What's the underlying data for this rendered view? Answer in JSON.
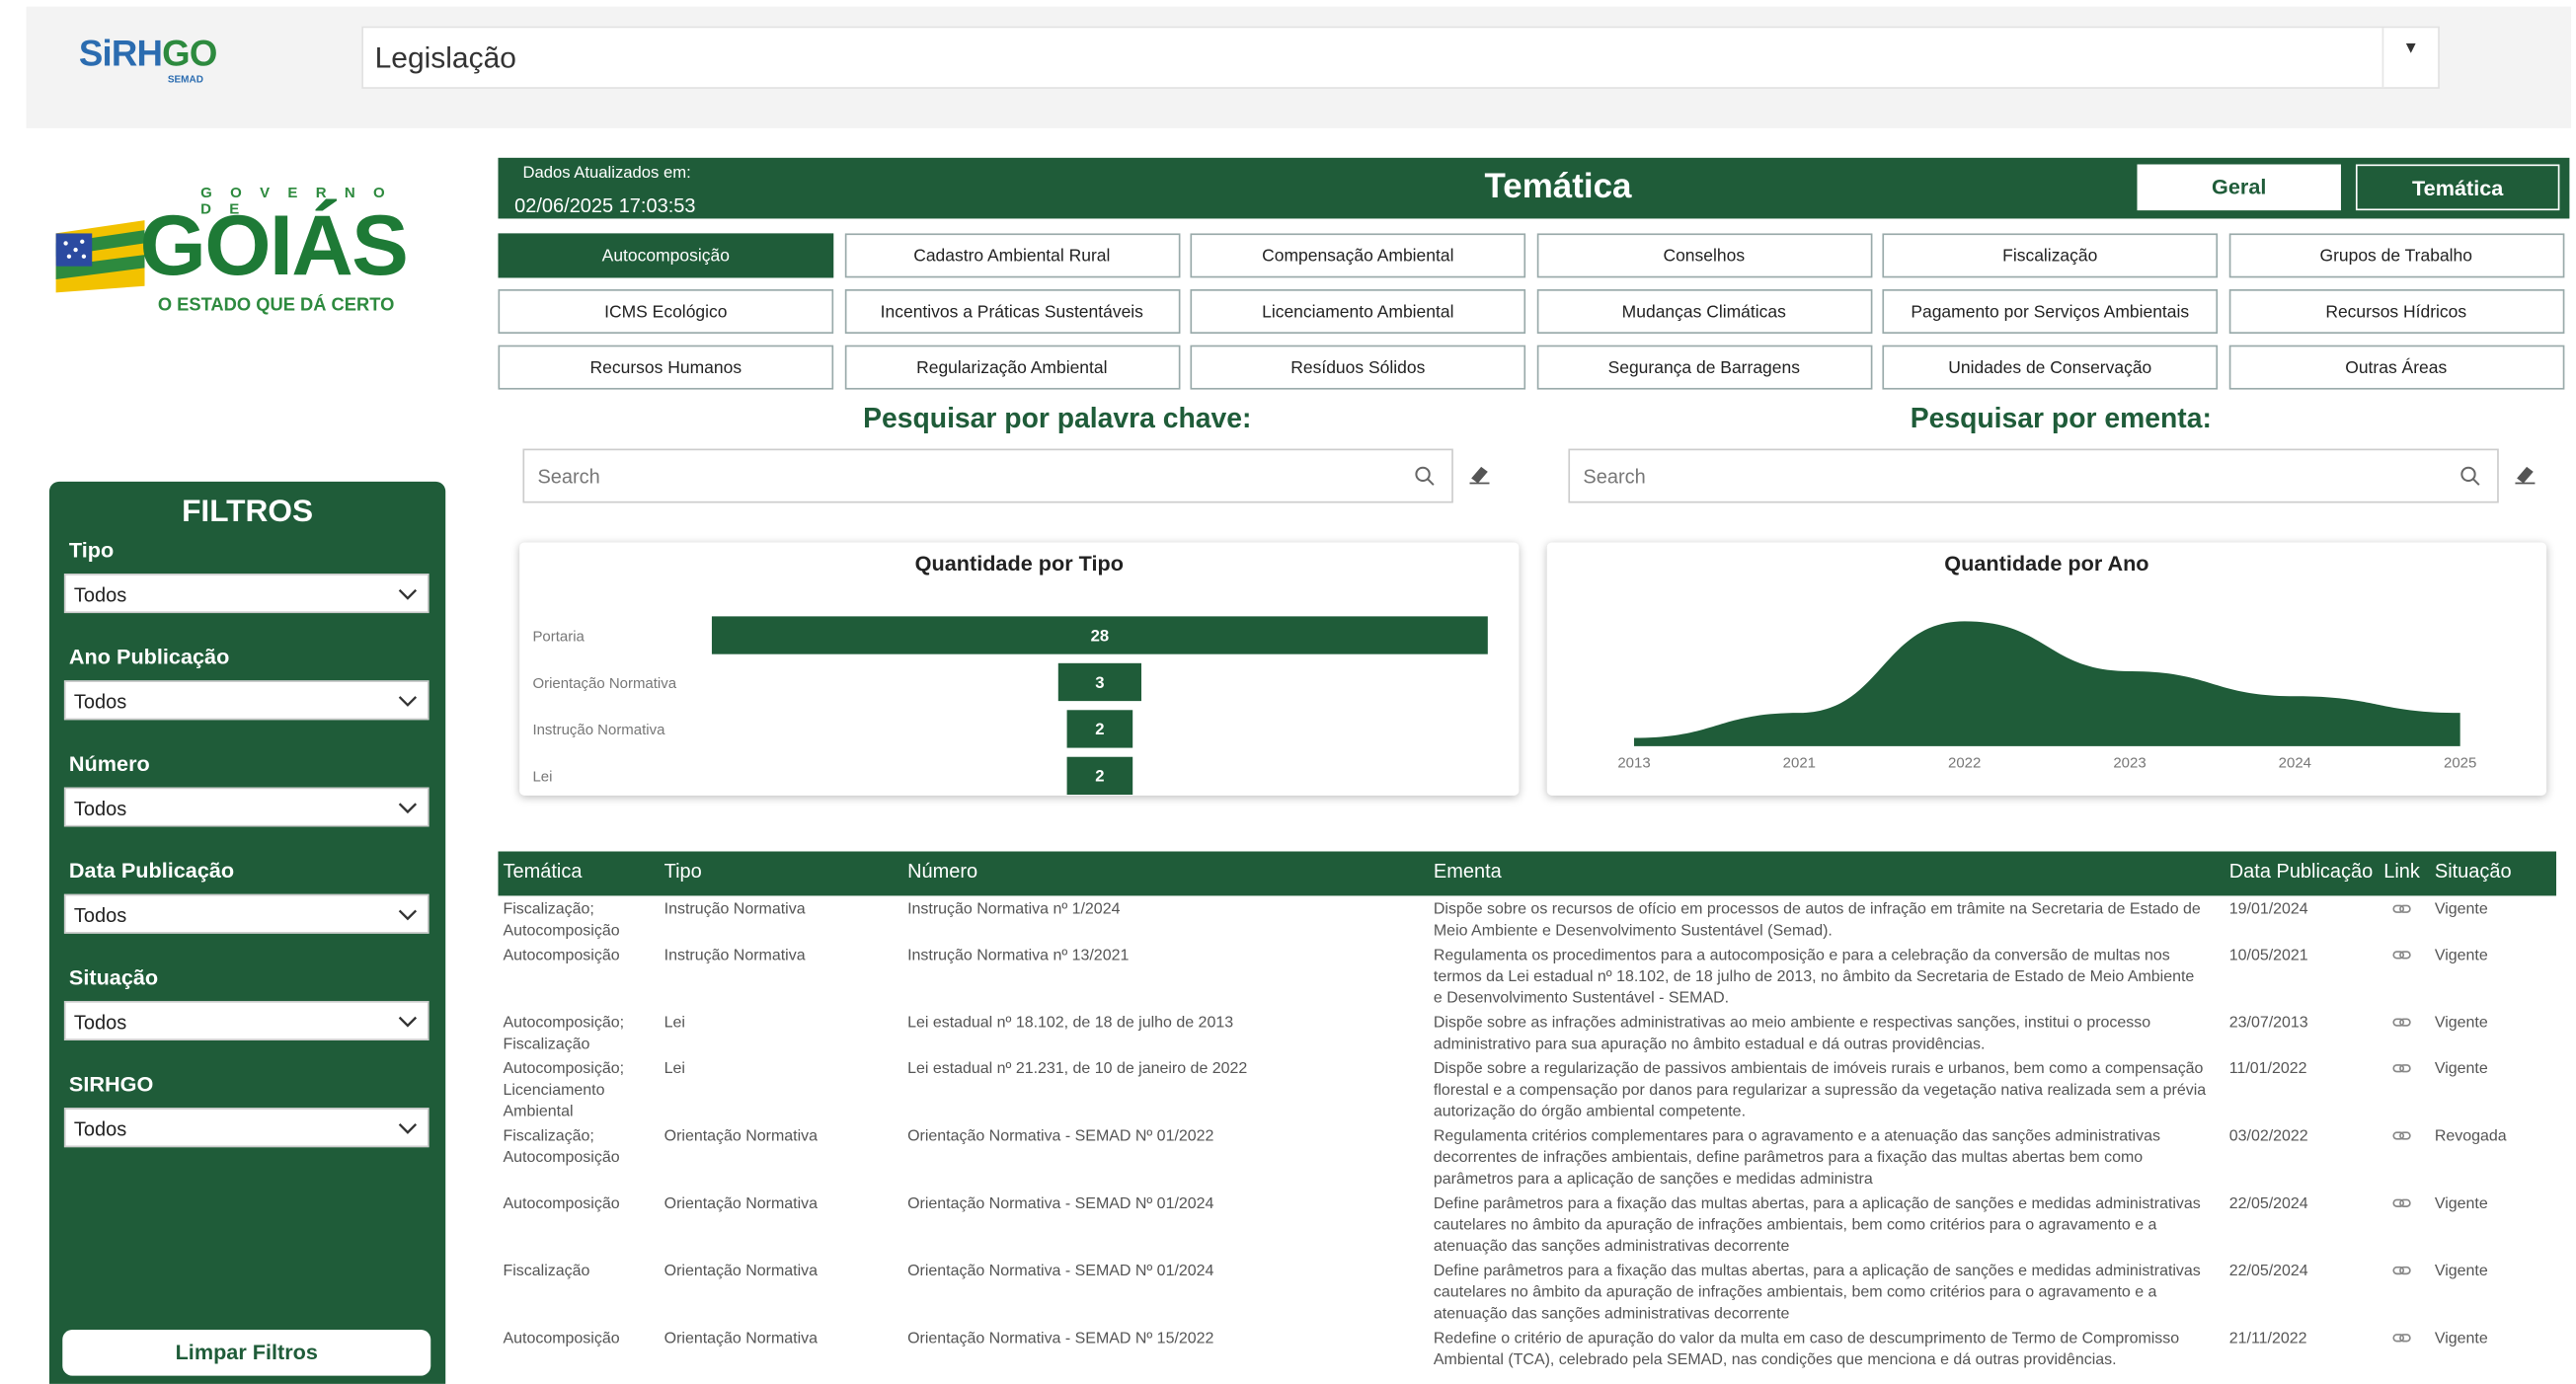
{
  "topbar": {
    "logo_text_a": "SIRHGO",
    "logo_sub": "SEMAD",
    "selected_page": "Legislação"
  },
  "brand": {
    "gov_label": "GOVERNO DE",
    "name": "GOIÁS",
    "slogan": "O ESTADO QUE DÁ CERTO"
  },
  "filters": {
    "title": "FILTROS",
    "items": [
      {
        "label": "Tipo",
        "value": "Todos"
      },
      {
        "label": "Ano Publicação",
        "value": "Todos"
      },
      {
        "label": "Número",
        "value": "Todos"
      },
      {
        "label": "Data Publicação",
        "value": "Todos"
      },
      {
        "label": "Situação",
        "value": "Todos"
      },
      {
        "label": "SIRHGO",
        "value": "Todos"
      }
    ],
    "clear_label": "Limpar Filtros"
  },
  "header": {
    "updated_label": "Dados Atualizados em:",
    "updated_value": "02/06/2025 17:03:53",
    "title": "Temática",
    "btn_geral": "Geral",
    "btn_tematica": "Temática"
  },
  "themes": [
    "Autocomposição",
    "Cadastro Ambiental Rural",
    "Compensação Ambiental",
    "Conselhos",
    "Fiscalização",
    "Grupos de Trabalho",
    "ICMS Ecológico",
    "Incentivos a Práticas Sustentáveis",
    "Licenciamento Ambiental",
    "Mudanças Climáticas",
    "Pagamento por Serviços Ambientais",
    "Recursos Hídricos",
    "Recursos Humanos",
    "Regularização Ambiental",
    "Resíduos Sólidos",
    "Segurança de Barragens",
    "Unidades de Conservação",
    "Outras Áreas"
  ],
  "active_theme": "Autocomposição",
  "search": {
    "keyword_label": "Pesquisar por palavra chave:",
    "keyword_placeholder": "Search",
    "ementa_label": "Pesquisar por ementa:",
    "ementa_placeholder": "Search"
  },
  "chart_data": [
    {
      "type": "bar",
      "orientation": "horizontal",
      "title": "Quantidade por Tipo",
      "categories": [
        "Portaria",
        "Orientação Normativa",
        "Instrução Normativa",
        "Lei"
      ],
      "values": [
        28,
        3,
        2,
        2
      ],
      "color": "#1f5c39"
    },
    {
      "type": "area",
      "title": "Quantidade por Ano",
      "x": [
        "2013",
        "2021",
        "2022",
        "2023",
        "2024",
        "2025"
      ],
      "values": [
        1,
        4,
        15,
        9,
        6,
        4
      ],
      "color": "#1f5c39"
    }
  ],
  "table": {
    "headers": [
      "Temática",
      "Tipo",
      "Número",
      "Ementa",
      "Data Publicação",
      "Link",
      "Situação"
    ],
    "rows": [
      {
        "tematica": [
          "Fiscalização;",
          "Autocomposição"
        ],
        "tipo": "Instrução Normativa",
        "numero": "Instrução Normativa nº 1/2024",
        "ementa": [
          "Dispõe sobre os recursos de ofício em processos de autos de infração em trâmite na Secretaria de Estado de",
          "Meio Ambiente e Desenvolvimento Sustentável (Semad)."
        ],
        "data": "19/01/2024",
        "situacao": "Vigente"
      },
      {
        "tematica": [
          "Autocomposição"
        ],
        "tipo": "Instrução Normativa",
        "numero": "Instrução Normativa nº 13/2021",
        "ementa": [
          "Regulamenta os procedimentos para a autocomposição e para a celebração da conversão de multas nos",
          "termos da Lei estadual nº 18.102, de 18 julho de 2013, no âmbito da Secretaria de Estado de Meio Ambiente",
          "e Desenvolvimento Sustentável - SEMAD."
        ],
        "data": "10/05/2021",
        "situacao": "Vigente"
      },
      {
        "tematica": [
          "Autocomposição;",
          "Fiscalização"
        ],
        "tipo": "Lei",
        "numero": "Lei estadual nº 18.102, de 18 de julho de 2013",
        "ementa": [
          "Dispõe sobre as infrações administrativas ao meio ambiente e respectivas sanções, institui o processo",
          "administrativo para sua apuração no âmbito estadual e dá outras providências."
        ],
        "data": "23/07/2013",
        "situacao": "Vigente"
      },
      {
        "tematica": [
          "Autocomposição;",
          "Licenciamento",
          "Ambiental"
        ],
        "tipo": "Lei",
        "numero": "Lei estadual nº 21.231, de 10 de janeiro de 2022",
        "ementa": [
          "Dispõe sobre a regularização de passivos ambientais de imóveis rurais e urbanos, bem como a compensação",
          "florestal e a compensação por danos para regularizar a supressão da vegetação nativa realizada sem a prévia",
          "autorização do órgão ambiental competente."
        ],
        "data": "11/01/2022",
        "situacao": "Vigente"
      },
      {
        "tematica": [
          "Fiscalização;",
          "Autocomposição"
        ],
        "tipo": "Orientação Normativa",
        "numero": "Orientação Normativa - SEMAD Nº 01/2022",
        "ementa": [
          "Regulamenta critérios complementares para o agravamento e a atenuação das sanções administrativas",
          "decorrentes de infrações ambientais, define parâmetros para a fixação das multas abertas bem como",
          "parâmetros para a aplicação de sanções e medidas administra"
        ],
        "data": "03/02/2022",
        "situacao": "Revogada"
      },
      {
        "tematica": [
          "Autocomposição"
        ],
        "tipo": "Orientação Normativa",
        "numero": "Orientação Normativa - SEMAD Nº 01/2024",
        "ementa": [
          "Define parâmetros para a fixação das multas abertas, para a aplicação de sanções e medidas administrativas",
          "cautelares no âmbito da apuração de infrações ambientais, bem como critérios para o agravamento e a",
          "atenuação das sanções administrativas decorrente"
        ],
        "data": "22/05/2024",
        "situacao": "Vigente"
      },
      {
        "tematica": [
          "Fiscalização"
        ],
        "tipo": "Orientação Normativa",
        "numero": "Orientação Normativa - SEMAD Nº 01/2024",
        "ementa": [
          "Define parâmetros para a fixação das multas abertas, para a aplicação de sanções e medidas administrativas",
          "cautelares no âmbito da apuração de infrações ambientais, bem como critérios para o agravamento e a",
          "atenuação das sanções administrativas decorrente"
        ],
        "data": "22/05/2024",
        "situacao": "Vigente"
      },
      {
        "tematica": [
          "Autocomposição"
        ],
        "tipo": "Orientação Normativa",
        "numero": "Orientação Normativa - SEMAD Nº 15/2022",
        "ementa": [
          "Redefine o critério de apuração do valor da multa em caso de descumprimento de Termo de Compromisso",
          "Ambiental (TCA), celebrado pela SEMAD, nas condições que menciona e dá outras providências."
        ],
        "data": "21/11/2022",
        "situacao": "Vigente"
      }
    ]
  }
}
